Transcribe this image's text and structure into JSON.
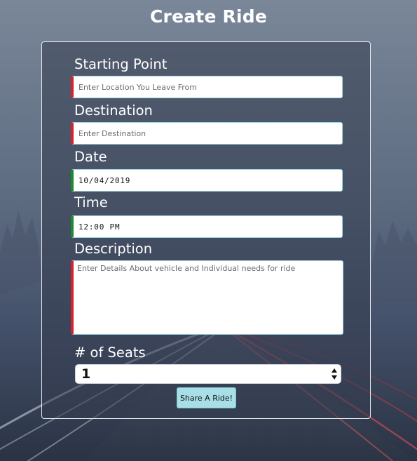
{
  "page": {
    "title": "Create Ride"
  },
  "form": {
    "starting_point": {
      "label": "Starting Point",
      "placeholder": "Enter Location You Leave From",
      "value": ""
    },
    "destination": {
      "label": "Destination",
      "placeholder": "Enter Destination",
      "value": ""
    },
    "date": {
      "label": "Date",
      "value": "10/04/2019"
    },
    "time": {
      "label": "Time",
      "value": "12:00 PM"
    },
    "description": {
      "label": "Description",
      "placeholder": "Enter Details About vehicle and Individual needs for ride"
    },
    "seats": {
      "label": "# of Seats",
      "selected": "1"
    },
    "submit_label": "Share A Ride!"
  },
  "colors": {
    "invalid_marker": "#d6232f",
    "valid_marker": "#1e8c2e",
    "button_bg": "#a8dfe6",
    "input_border": "#9fd6df"
  },
  "icons": {
    "select_arrows": "up-down-arrows-icon"
  }
}
